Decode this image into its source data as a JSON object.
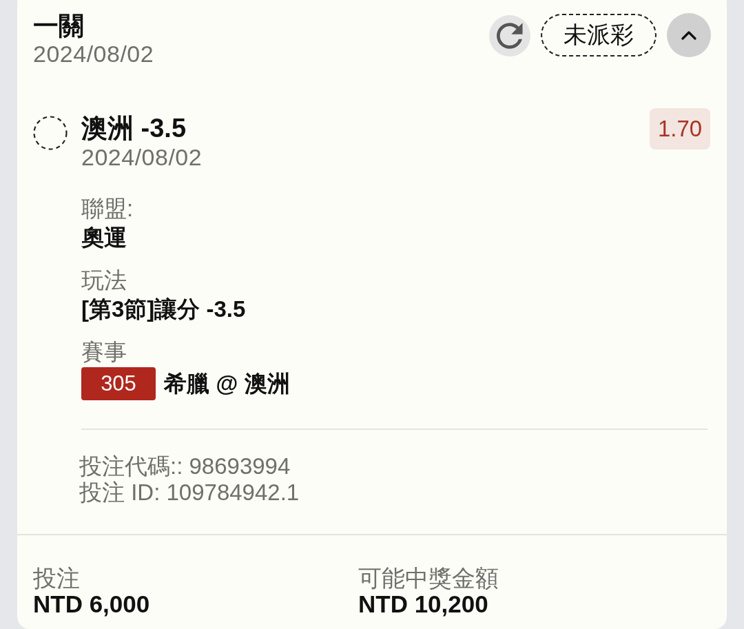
{
  "bet": {
    "title": "一關",
    "date": "2024/08/02",
    "status": "未派彩",
    "expanded": true
  },
  "selection": {
    "settled": false,
    "name": "澳洲 -3.5",
    "date": "2024/08/02",
    "odds": "1.70"
  },
  "details": [
    {
      "kind": "text",
      "label": "聯盟:",
      "value": "奧運"
    },
    {
      "kind": "text",
      "label": "玩法",
      "value": "[第3節]讓分 -3.5"
    },
    {
      "kind": "event",
      "label": "賽事",
      "code": "305",
      "value": "希臘 @ 澳洲"
    }
  ],
  "references": [
    "投注代碼:: 98693994",
    "投注 ID: 109784942.1"
  ],
  "summary": [
    {
      "label": "投注",
      "amount": "NTD 6,000"
    },
    {
      "label": "可能中獎金額",
      "amount": "NTD 10,200"
    }
  ]
}
